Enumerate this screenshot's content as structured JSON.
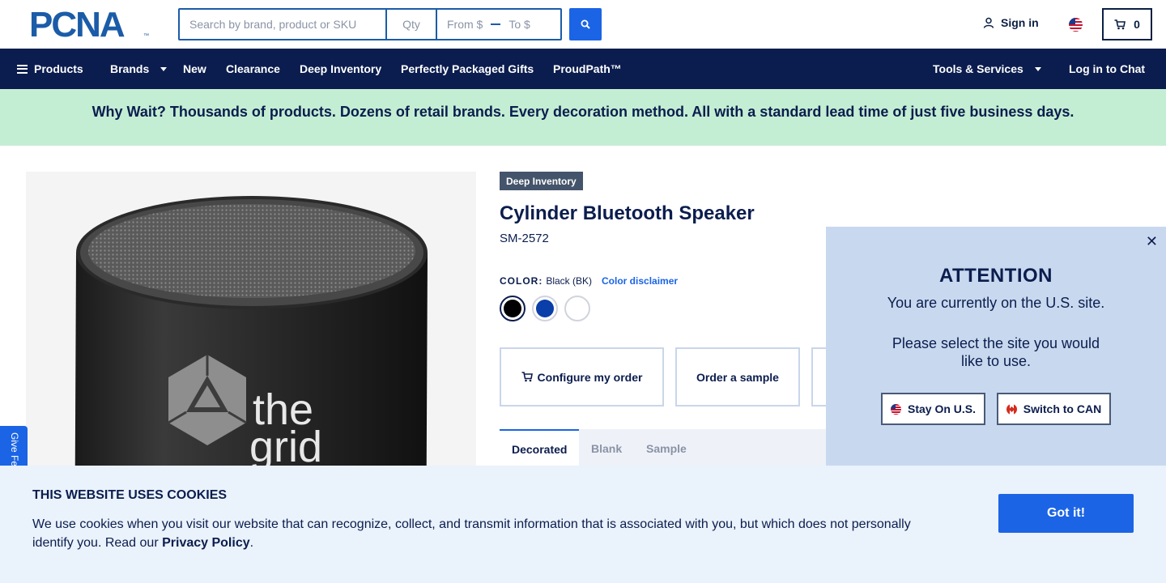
{
  "header": {
    "logo_text": "PCNA",
    "logo_tm": "™",
    "search_placeholder": "Search by brand, product or SKU",
    "qty_placeholder": "Qty",
    "price_from_placeholder": "From $",
    "price_to_placeholder": "To $",
    "signin_label": "Sign in",
    "cart_count": "0"
  },
  "nav": {
    "items": [
      {
        "label": "Products"
      },
      {
        "label": "Brands"
      },
      {
        "label": "New"
      },
      {
        "label": "Clearance"
      },
      {
        "label": "Deep Inventory"
      },
      {
        "label": "Perfectly Packaged Gifts"
      },
      {
        "label": "ProudPath™"
      }
    ],
    "tools_label": "Tools & Services",
    "chat_label": "Log in to Chat"
  },
  "promo": {
    "text": "Why Wait? Thousands of products. Dozens of retail brands. Every decoration method. All with a standard lead time of just five business days."
  },
  "product": {
    "badge": "Deep Inventory",
    "title": "Cylinder Bluetooth Speaker",
    "sku": "SM-2572",
    "color_label": "COLOR:",
    "color_value": "Black (BK)",
    "color_disclaimer": "Color disclaimer",
    "swatches": [
      {
        "name": "black",
        "color": "#000000"
      },
      {
        "name": "blue",
        "color": "#0a3ea8"
      },
      {
        "name": "white",
        "color": "#ffffff"
      }
    ],
    "image_logo_text_1": "the",
    "image_logo_text_2": "grid",
    "actions": {
      "configure": "Configure my order",
      "sample": "Order a sample"
    },
    "tabs": [
      "Decorated",
      "Blank",
      "Sample"
    ]
  },
  "feedback": {
    "label": "Give Fe"
  },
  "attention": {
    "title": "ATTENTION",
    "line1": "You are currently on the U.S. site.",
    "line2": "Please select the site you would like to use.",
    "stay_label": "Stay On U.S.",
    "switch_label": "Switch to CAN",
    "close": "✕"
  },
  "cookie": {
    "title": "THIS WEBSITE USES COOKIES",
    "text": "We use cookies when you visit our website that can recognize, collect, and transmit information that is associated with you, but which does not personally identify you. Read our ",
    "link": "Privacy Policy",
    "end": ".",
    "button": "Got it!"
  },
  "colors": {
    "navy": "#0b1d4e",
    "brand_blue": "#1b64e5",
    "promo_green": "#c4eed3",
    "modal_bg": "#c8d9ef",
    "cookie_bg": "#eaf2fb"
  }
}
